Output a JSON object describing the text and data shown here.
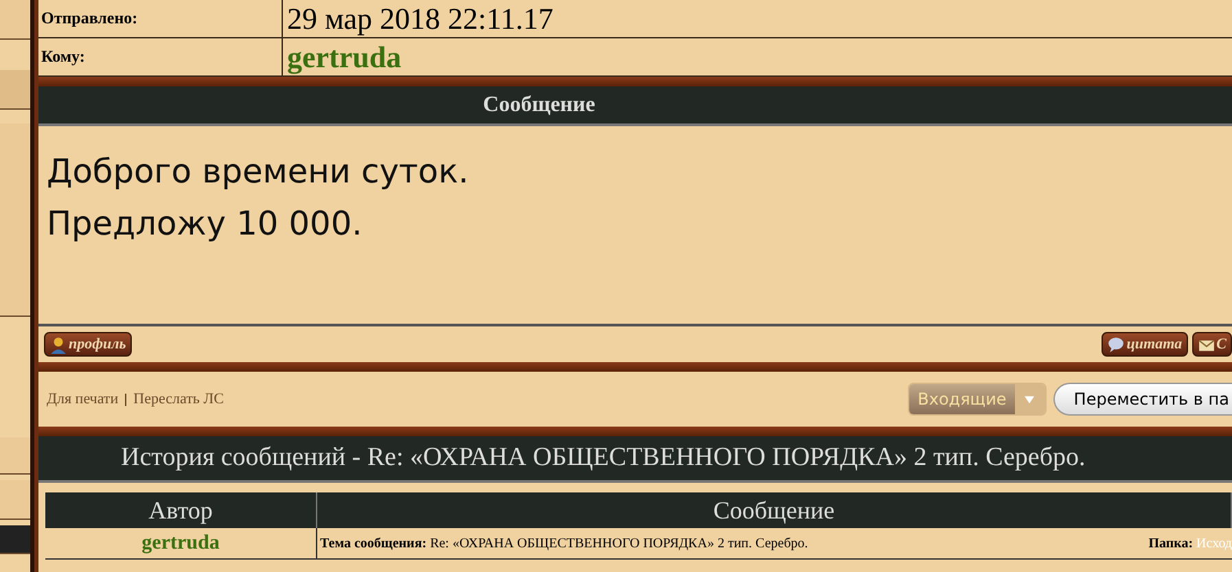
{
  "details": [
    {
      "label": "Отправлено:",
      "value": "29 мар 2018 22:11.17",
      "kind": "date"
    },
    {
      "label": "Кому:",
      "value": "gertruda",
      "kind": "user"
    }
  ],
  "message": {
    "title": "Сообщение",
    "lines": [
      "Доброго времени суток.",
      "Предложу 10 000."
    ]
  },
  "actions": {
    "left": [
      {
        "label": "профиль",
        "kind": "profile"
      }
    ],
    "right": [
      {
        "label": "цитата",
        "kind": "quote"
      },
      {
        "label": "С",
        "kind": "mail"
      }
    ]
  },
  "tools": {
    "links": [
      "Для печати",
      "Переслать ЛС"
    ],
    "folder_select": "Входящие",
    "move_button": "Переместить в па"
  },
  "history": {
    "title": "История сообщений - Re: «ОХРАНА ОБЩЕСТВЕННОГО ПОРЯДКА» 2 тип. Серебро.",
    "columns": [
      "Автор",
      "Сообщение"
    ],
    "rows": [
      {
        "author": "gertruda",
        "subject_label": "Тема сообщения:",
        "subject": "Re: «ОХРАНА ОБЩЕСТВЕННОГО ПОРЯДКА» 2 тип. Серебро.",
        "folder_label": "Папка:",
        "folder": "Исход"
      }
    ]
  }
}
